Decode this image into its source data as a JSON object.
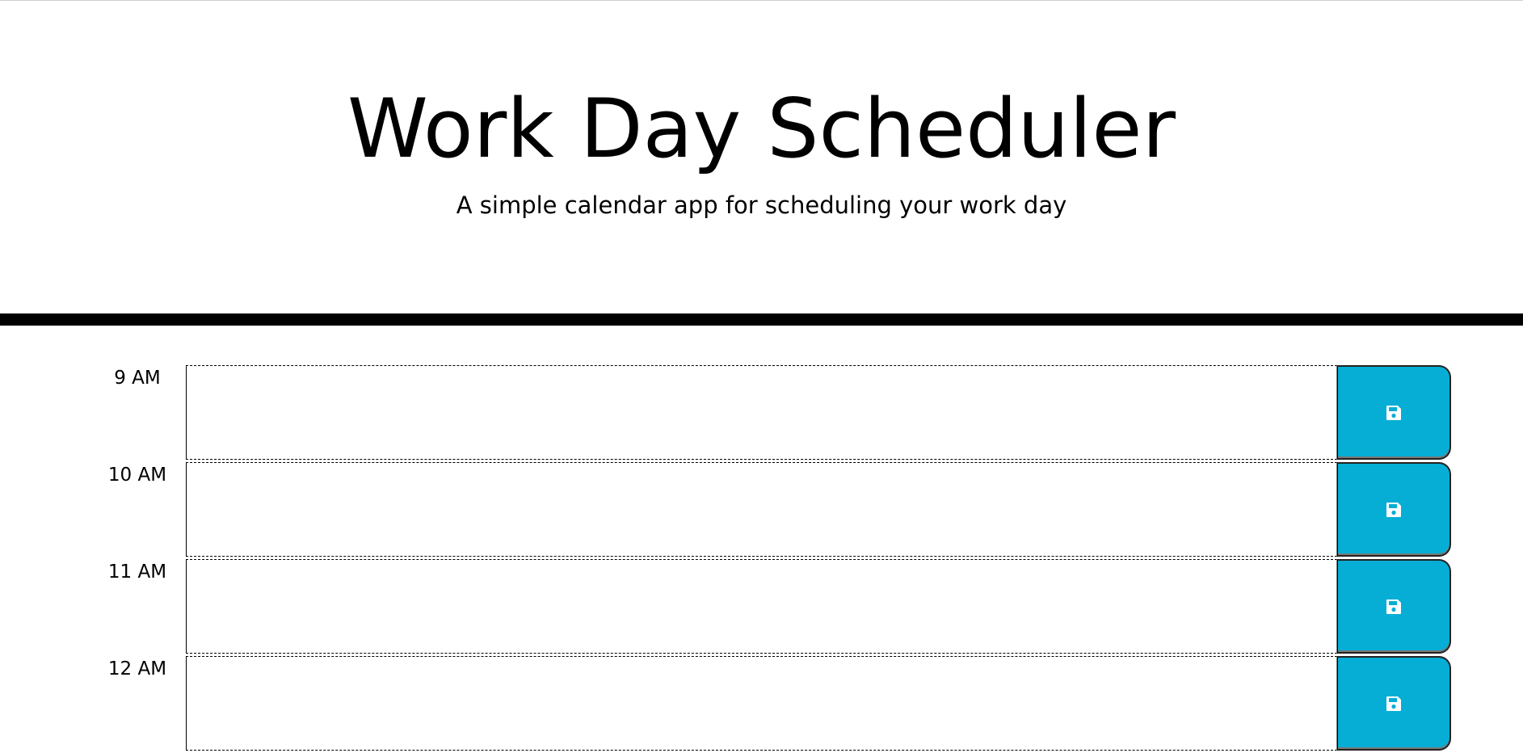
{
  "header": {
    "title": "Work Day Scheduler",
    "subtitle": "A simple calendar app for scheduling your work day"
  },
  "colors": {
    "save_button": "#06aed5",
    "header_bar": "#000000"
  },
  "timeblocks": [
    {
      "hour": "9 AM",
      "description": "",
      "save_icon": "floppy-disk-icon"
    },
    {
      "hour": "10 AM",
      "description": "",
      "save_icon": "floppy-disk-icon"
    },
    {
      "hour": "11 AM",
      "description": "",
      "save_icon": "floppy-disk-icon"
    },
    {
      "hour": "12 AM",
      "description": "",
      "save_icon": "floppy-disk-icon"
    }
  ]
}
